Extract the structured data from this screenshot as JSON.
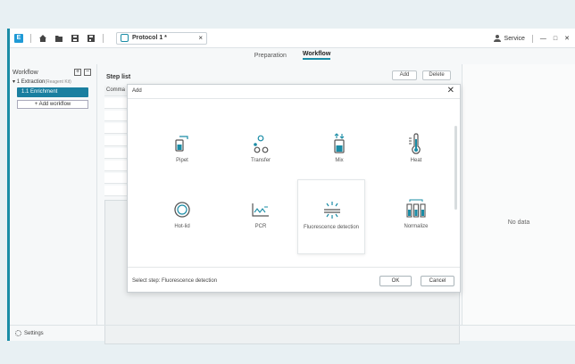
{
  "titlebar": {
    "logo": "E",
    "tab_label": "Protocol 1 *",
    "tab_close": "×",
    "user": "Service",
    "minimize": "—",
    "maximize": "□",
    "close": "✕"
  },
  "subtabs": [
    {
      "label": "Preparation"
    },
    {
      "label": "Workflow",
      "active": true
    }
  ],
  "sidebar": {
    "workflow_label": "Workflow",
    "expand_symbol": "+",
    "collapse_symbol": "−",
    "tree_root": "1 Extraction",
    "tree_root_note": "(Reagent Kit)",
    "tree_child": "1.1 Enrichment",
    "add_workflow": "+ Add workflow"
  },
  "main": {
    "step_list_title": "Step list",
    "add_button": "Add",
    "delete_button": "Delete",
    "first_column": "Comma"
  },
  "right_pane": {
    "no_data": "No data"
  },
  "statusbar": {
    "settings": "Settings"
  },
  "dialog": {
    "title": "Add",
    "close": "✕",
    "tiles": [
      {
        "label": "Pipet",
        "icon": "pipet-icon"
      },
      {
        "label": "Transfer",
        "icon": "transfer-icon"
      },
      {
        "label": "Mix",
        "icon": "mix-icon"
      },
      {
        "label": "Heat",
        "icon": "heat-icon"
      },
      {
        "label": "Hot-lid",
        "icon": "hot-lid-icon"
      },
      {
        "label": "PCR",
        "icon": "pcr-icon"
      },
      {
        "label": "Fluorescence detection",
        "icon": "fluorescence-icon",
        "selected": true
      },
      {
        "label": "Normalize",
        "icon": "normalize-icon"
      }
    ],
    "status": "Select step: Fluorescence detection",
    "ok": "OK",
    "cancel": "Cancel"
  },
  "colors": {
    "accent": "#1a8ca6",
    "selected_item": "#1a7fa0",
    "background": "#e8f0f3"
  }
}
